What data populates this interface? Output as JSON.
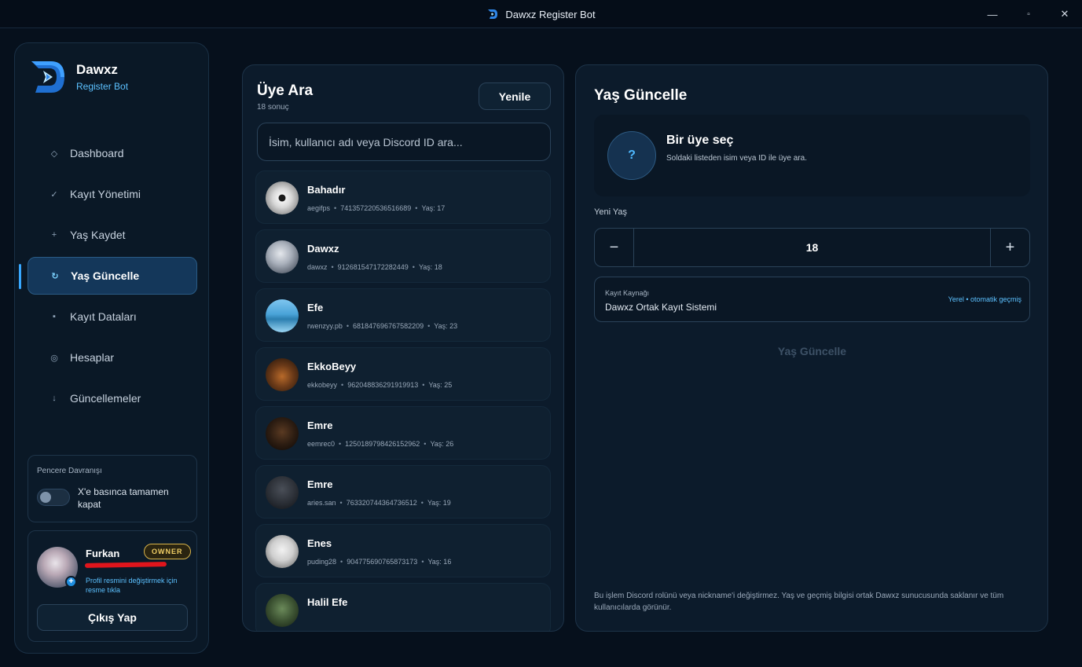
{
  "window": {
    "title": "Dawxz Register Bot",
    "controls": {
      "minimize": "—",
      "maximize": "▫",
      "close": "✕"
    }
  },
  "brand": {
    "name": "Dawxz",
    "subtitle": "Register Bot"
  },
  "sidebar": {
    "items": [
      {
        "label": "Dashboard",
        "icon": "◇",
        "icon_name": "diamond-icon",
        "active": false
      },
      {
        "label": "Kayıt Yönetimi",
        "icon": "✓",
        "icon_name": "check-icon",
        "active": false
      },
      {
        "label": "Yaş Kaydet",
        "icon": "+",
        "icon_name": "plus-icon",
        "active": false
      },
      {
        "label": "Yaş Güncelle",
        "icon": "↻",
        "icon_name": "refresh-icon",
        "active": true
      },
      {
        "label": "Kayıt Dataları",
        "icon": "▪",
        "icon_name": "database-icon",
        "active": false
      },
      {
        "label": "Hesaplar",
        "icon": "◎",
        "icon_name": "accounts-icon",
        "active": false
      },
      {
        "label": "Güncellemeler",
        "icon": "↓",
        "icon_name": "download-icon",
        "active": false
      }
    ],
    "window_behavior": {
      "title": "Pencere Davranışı",
      "toggle_label": "X'e basınca tamamen kapat",
      "toggle_on": false
    },
    "user": {
      "name": "Furkan",
      "badge": "OWNER",
      "hint": "Profil resmini değiştirmek için resme tıkla",
      "logout_label": "Çıkış Yap"
    }
  },
  "search": {
    "title": "Üye Ara",
    "result_count": "18 sonuç",
    "refresh_label": "Yenile",
    "placeholder": "İsim, kullanıcı adı veya Discord ID ara...",
    "members": [
      {
        "name": "Bahadır",
        "username": "aegifps",
        "id": "741357220536516689",
        "age": "Yaş: 17"
      },
      {
        "name": "Dawxz",
        "username": "dawxz",
        "id": "912681547172282449",
        "age": "Yaş: 18"
      },
      {
        "name": "Efe",
        "username": "rwenzyy.pb",
        "id": "681847696767582209",
        "age": "Yaş: 23"
      },
      {
        "name": "EkkoBeyy",
        "username": "ekkobeyy",
        "id": "962048836291919913",
        "age": "Yaş: 25"
      },
      {
        "name": "Emre",
        "username": "eemrec0",
        "id": "1250189798426152962",
        "age": "Yaş: 26"
      },
      {
        "name": "Emre",
        "username": "aries.san",
        "id": "763320744364736512",
        "age": "Yaş: 19"
      },
      {
        "name": "Enes",
        "username": "puding28",
        "id": "904775690765873173",
        "age": "Yaş: 16"
      },
      {
        "name": "Halil Efe",
        "username": "",
        "id": "",
        "age": ""
      }
    ]
  },
  "update": {
    "title": "Yaş Güncelle",
    "select_title": "Bir üye seç",
    "select_subtitle": "Soldaki listeden isim veya ID ile üye ara.",
    "select_symbol": "?",
    "age_label": "Yeni Yaş",
    "age_value": "18",
    "minus": "−",
    "plus": "+",
    "source_label": "Kayıt Kaynağı",
    "source_value": "Dawxz Ortak Kayıt Sistemi",
    "source_note": "Yerel • otomatik geçmiş",
    "submit_label": "Yaş Güncelle",
    "footnote": "Bu işlem Discord rolünü veya nickname'i değiştirmez. Yaş ve geçmiş bilgisi ortak Dawxz sunucusunda saklanır ve tüm kullanıcılarda görünür."
  },
  "colors": {
    "accent": "#38a8ff",
    "link": "#5cc1ff",
    "owner_badge": "#f1cf66",
    "background": "#06101c"
  }
}
